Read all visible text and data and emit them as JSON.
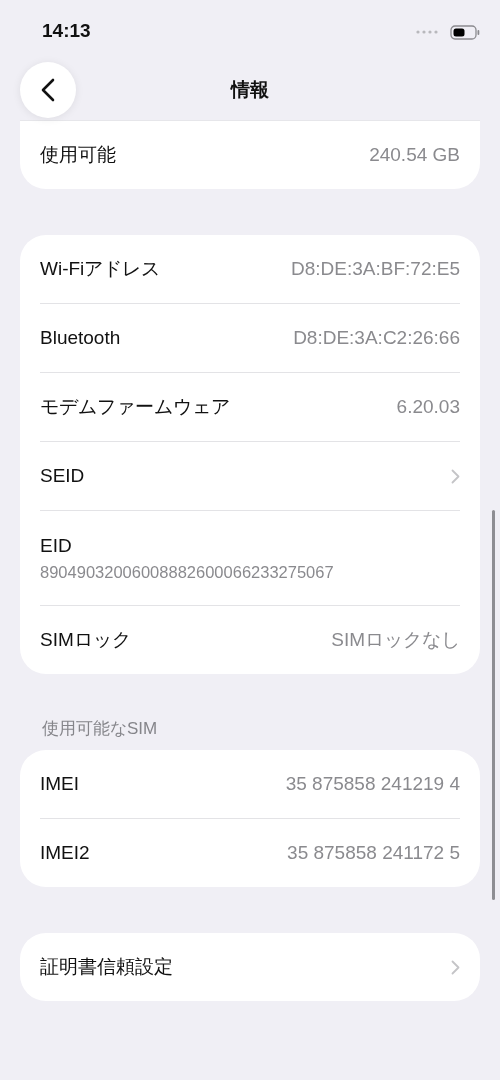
{
  "status_bar": {
    "time": "14:13"
  },
  "nav": {
    "title": "情報"
  },
  "groups": [
    {
      "rows": [
        {
          "kind": "value",
          "label": "使用可能",
          "value": "240.54 GB"
        }
      ]
    },
    {
      "rows": [
        {
          "kind": "value",
          "label": "Wi-Fiアドレス",
          "value": "D8:DE:3A:BF:72:E5"
        },
        {
          "kind": "value",
          "label": "Bluetooth",
          "value": "D8:DE:3A:C2:26:66"
        },
        {
          "kind": "value",
          "label": "モデムファームウェア",
          "value": "6.20.03"
        },
        {
          "kind": "chevron",
          "label": "SEID"
        },
        {
          "kind": "stacked",
          "label": "EID",
          "value": "89049032006008882600066233275067"
        },
        {
          "kind": "value",
          "label": "SIMロック",
          "value": "SIMロックなし"
        }
      ]
    },
    {
      "header": "使用可能なSIM",
      "rows": [
        {
          "kind": "value",
          "label": "IMEI",
          "value": "35 875858 241219 4"
        },
        {
          "kind": "value",
          "label": "IMEI2",
          "value": "35 875858 241172 5"
        }
      ]
    },
    {
      "rows": [
        {
          "kind": "chevron",
          "label": "証明書信頼設定"
        }
      ]
    }
  ]
}
